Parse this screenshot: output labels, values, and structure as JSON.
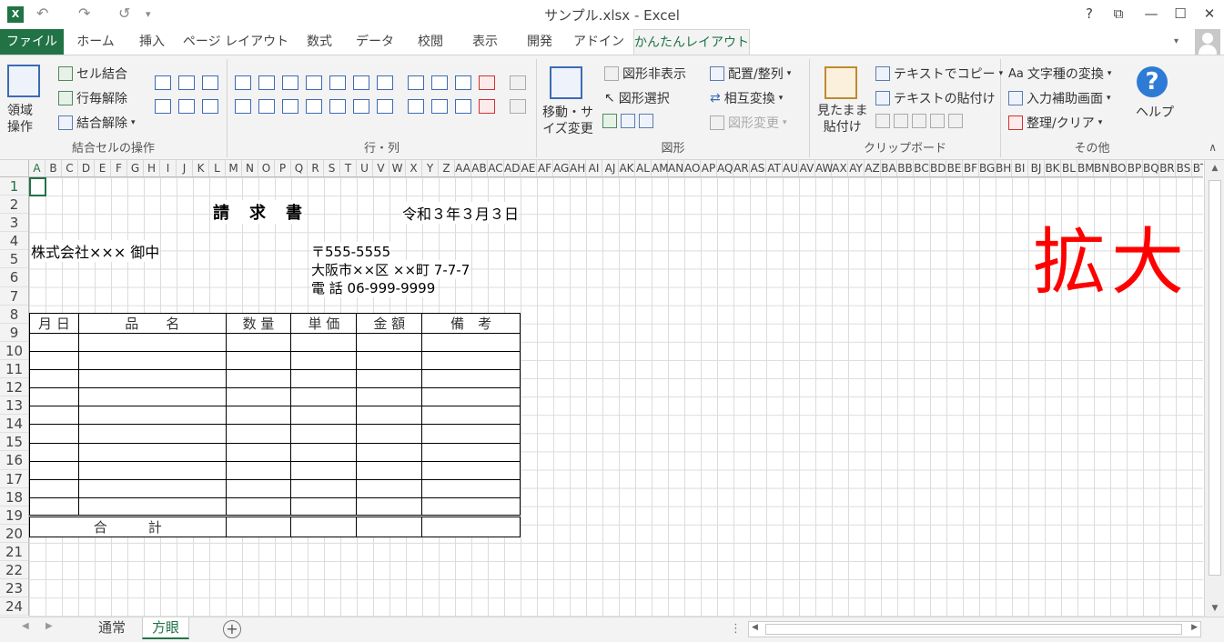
{
  "app": {
    "title": "サンプル.xlsx - Excel",
    "logo": "X",
    "window_buttons": [
      "?",
      "⧉",
      "—",
      "☐",
      "✕"
    ]
  },
  "tabs": [
    "ファイル",
    "ホーム",
    "挿入",
    "ページ レイアウト",
    "数式",
    "データ",
    "校閲",
    "表示",
    "開発",
    "アドイン",
    "かんたんレイアウト"
  ],
  "ribbon": {
    "groups": {
      "merge": {
        "label": "結合セルの操作",
        "area_op": "領域\n操作",
        "cell_merge": "セル結合",
        "row_unmerge": "行毎解除",
        "unmerge": "結合解除"
      },
      "rowcol": {
        "label": "行・列"
      },
      "shape": {
        "label": "図形",
        "move_resize": "移動・サ\nイズ変更",
        "hide_shape": "図形非表示",
        "select_shape": "図形選択",
        "arrange": "配置/整列",
        "swap": "相互変換",
        "change_shape": "図形変更"
      },
      "clipboard": {
        "label": "クリップボード",
        "paste_as_seen": "見たまま\n貼付け",
        "copy_text": "テキストでコピー",
        "paste_text": "テキストの貼付け"
      },
      "other": {
        "label": "その他",
        "char_convert": "文字種の変換",
        "input_help": "入力補助画面",
        "organize_clear": "整理/クリア",
        "help": "ヘルプ"
      }
    }
  },
  "sheet": {
    "columns": [
      "A",
      "B",
      "C",
      "D",
      "E",
      "F",
      "G",
      "H",
      "I",
      "J",
      "K",
      "L",
      "M",
      "N",
      "O",
      "P",
      "Q",
      "R",
      "S",
      "T",
      "U",
      "V",
      "W",
      "X",
      "Y",
      "Z",
      "AA",
      "AB",
      "AC",
      "AD",
      "AE",
      "AF",
      "AG",
      "AH",
      "AI",
      "AJ",
      "AK",
      "AL",
      "AM",
      "AN",
      "AO",
      "AP",
      "AQ",
      "AR",
      "AS",
      "AT",
      "AU",
      "AV",
      "AW",
      "AX",
      "AY",
      "AZ",
      "BA",
      "BB",
      "BC",
      "BD",
      "BE",
      "BF",
      "BG",
      "BH",
      "BI",
      "BJ",
      "BK",
      "BL",
      "BM",
      "BN",
      "BO",
      "BP",
      "BQ",
      "BR",
      "BS",
      "BT"
    ],
    "rows": [
      "1",
      "2",
      "3",
      "4",
      "5",
      "6",
      "7",
      "8",
      "9",
      "10",
      "11",
      "12",
      "13",
      "14",
      "15",
      "16",
      "17",
      "18",
      "19",
      "20",
      "21",
      "22",
      "23",
      "24"
    ],
    "invoice_title": "請　求　書",
    "date": "令和３年３月３日",
    "customer": "株式会社×××  御中",
    "zip": "〒555-5555",
    "address": "大阪市××区 ××町 7-7-7",
    "phone": "電 話 06-999-9999",
    "table": {
      "headers": [
        "月 日",
        "品　　名",
        "数 量",
        "単 価",
        "金 額",
        "備　考"
      ],
      "body_rows": 10,
      "total_label": "合　　　計"
    },
    "zoom_label": "拡大"
  },
  "sheet_tabs": [
    "通常",
    "方眼"
  ],
  "active_sheet": "方眼"
}
